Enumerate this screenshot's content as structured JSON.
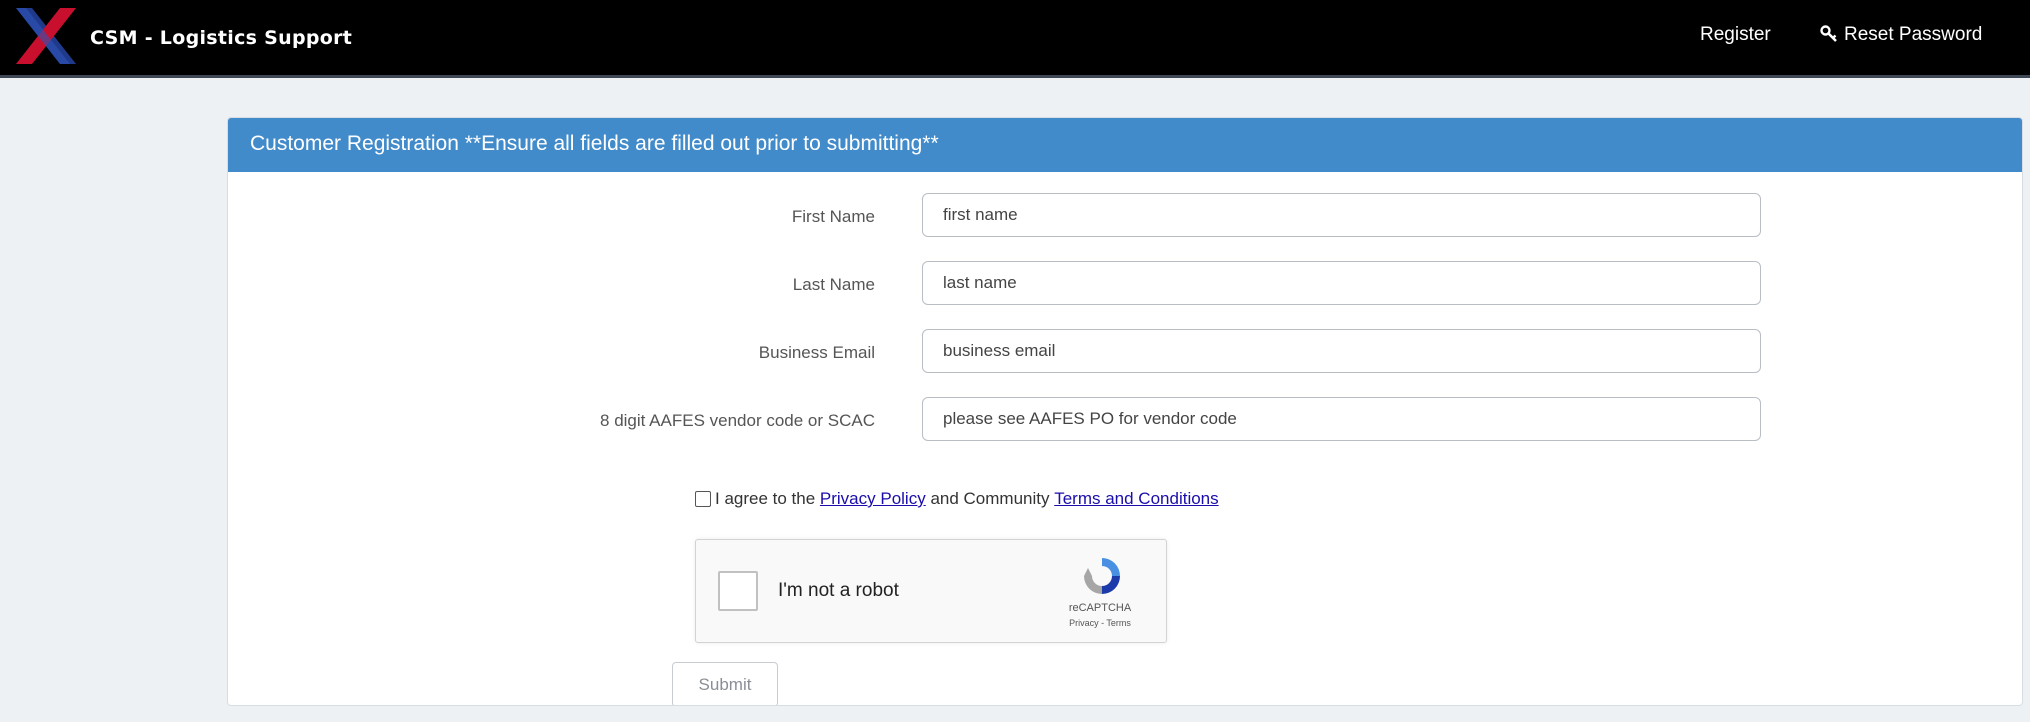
{
  "header": {
    "app_title": "CSM - Logistics Support",
    "register_label": "Register",
    "reset_password_label": "Reset Password"
  },
  "form": {
    "title": "Customer Registration **Ensure all fields are filled out prior to submitting**",
    "fields": [
      {
        "label": "First Name",
        "placeholder": "first name",
        "value": ""
      },
      {
        "label": "Last Name",
        "placeholder": "last name",
        "value": ""
      },
      {
        "label": "Business Email",
        "placeholder": "business email",
        "value": ""
      },
      {
        "label": "8 digit AAFES vendor code or SCAC",
        "placeholder": "please see AAFES PO for vendor code",
        "value": ""
      }
    ],
    "agree": {
      "checked": false,
      "prefix": "I agree to the ",
      "privacy_link": "Privacy Policy",
      "middle": " and Community ",
      "terms_link": "Terms and Conditions"
    },
    "captcha": {
      "label": "I'm not a robot",
      "brand": "reCAPTCHA",
      "links": "Privacy - Terms"
    },
    "submit_label": "Submit"
  },
  "colors": {
    "topbar": "#000000",
    "panel_header": "#428bca",
    "page_bg": "#eef1f4",
    "link": "#1a0dab"
  }
}
